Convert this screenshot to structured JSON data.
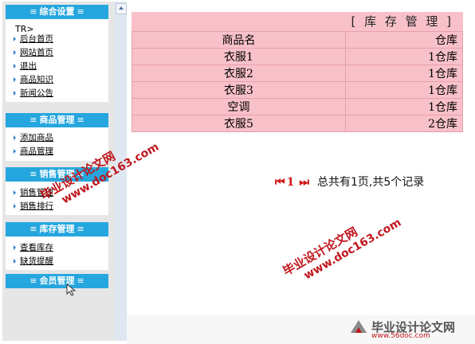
{
  "sidebar": {
    "sections": [
      {
        "title": "综合设置",
        "pre_text": "TR>",
        "items": [
          "后台首页",
          "网站首页",
          "退出",
          "商品知识",
          "新闻公告"
        ]
      },
      {
        "title": "商品管理",
        "items": [
          "添加商品",
          "商品管理"
        ]
      },
      {
        "title": "销售管理",
        "items": [
          "销售管理",
          "销售排行"
        ]
      },
      {
        "title": "库存管理",
        "items": [
          "查看库存",
          "缺货提醒"
        ]
      },
      {
        "title": "会员管理",
        "items": []
      }
    ],
    "eq_mark": "≡"
  },
  "main": {
    "table_title": "[ 库 存 管 理 ]",
    "columns": [
      "商品名",
      "仓库"
    ],
    "rows": [
      [
        "衣服1",
        "1仓库"
      ],
      [
        "衣服2",
        "1仓库"
      ],
      [
        "衣服3",
        "1仓库"
      ],
      [
        "空调",
        "1仓库"
      ],
      [
        "衣服5",
        "2仓库"
      ]
    ],
    "pager": {
      "first": "⏮",
      "current": "1",
      "last": "⏭",
      "summary": "总共有1页,共5个记录"
    }
  },
  "watermark": {
    "line1": "毕业设计论文网",
    "line2": "www.doc163.com",
    "logo_text": "毕业设计论文网",
    "logo_url": "www.56doc.com"
  },
  "colors": {
    "section_header": "#26a6de",
    "table_bg": "#f8c1c9",
    "watermark": "#c0171d"
  }
}
